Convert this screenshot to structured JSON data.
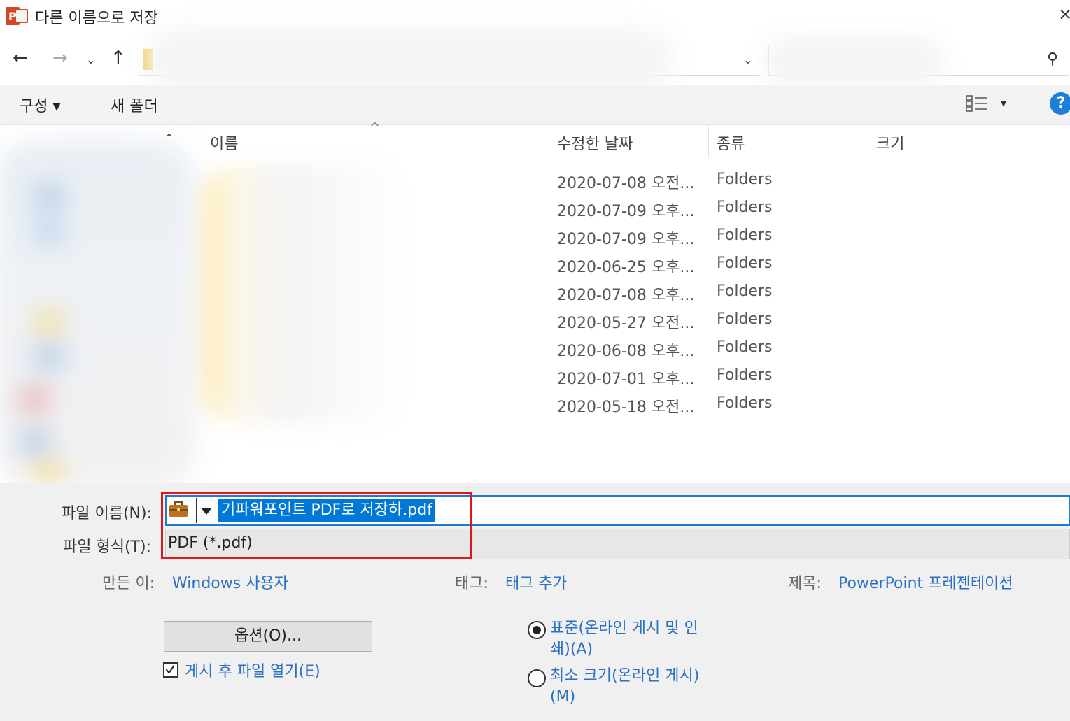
{
  "window": {
    "title": "다른 이름으로 저장",
    "close_glyph": "×"
  },
  "nav": {
    "back_glyph": "←",
    "forward_glyph": "→",
    "recent_glyph": "⌄",
    "up_glyph": "↑",
    "address_dropdown_glyph": "⌄",
    "search_glyph": "⚲"
  },
  "toolbar": {
    "organize_label": "구성 ▾",
    "new_folder_label": "새 폴더",
    "view_dropdown_glyph": "▾",
    "help_glyph": "?"
  },
  "columns": {
    "name": "이름",
    "sort_glyph": "^",
    "date": "수정한 날짜",
    "type": "종류",
    "size": "크기"
  },
  "rows": [
    {
      "date": "2020-07-08 오전...",
      "type": "Folders"
    },
    {
      "date": "2020-07-09 오후...",
      "type": "Folders"
    },
    {
      "date": "2020-07-09 오후...",
      "type": "Folders"
    },
    {
      "date": "2020-06-25 오후...",
      "type": "Folders"
    },
    {
      "date": "2020-07-08 오후...",
      "type": "Folders"
    },
    {
      "date": "2020-05-27 오전...",
      "type": "Folders"
    },
    {
      "date": "2020-06-08 오후...",
      "type": "Folders"
    },
    {
      "date": "2020-07-01 오후...",
      "type": "Folders"
    },
    {
      "date": "2020-05-18 오전...",
      "type": "Folders"
    }
  ],
  "save": {
    "filename_label": "파일 이름(N):",
    "filename_value": "기파워포인트 PDF로 저장하.pdf",
    "filetype_label": "파일 형식(T):",
    "filetype_value": "PDF (*.pdf)"
  },
  "meta": {
    "author_label": "만든 이:",
    "author_value": "Windows 사용자",
    "tags_label": "태그:",
    "tags_value": "태그 추가",
    "title_label": "제목:",
    "title_value": "PowerPoint 프레젠테이션"
  },
  "options": {
    "button_label": "옵션(O)...",
    "open_after_label": "게시 후 파일 열기(E)",
    "open_after_checked": "✓",
    "radio_standard_label": "표준(온라인 게시 및 인쇄)(A)",
    "radio_minimum_label": "최소 크기(온라인 게시)(M)"
  },
  "colors": {
    "accent": "#0078d7",
    "link": "#2b71c3",
    "highlight": "#e0161c"
  }
}
